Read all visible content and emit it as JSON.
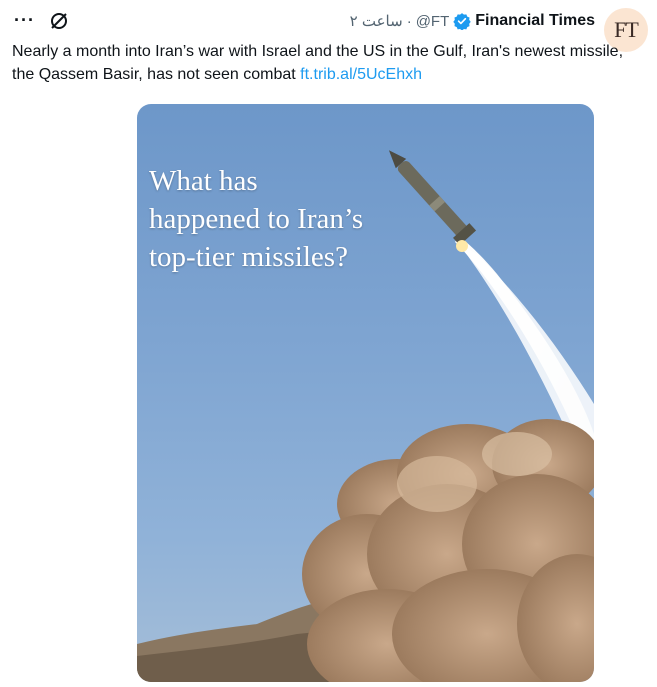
{
  "header": {
    "avatar_text": "FT",
    "name": "Financial Times",
    "handle": "@FT",
    "separator": "·",
    "time": "ساعت ۲"
  },
  "menu": {
    "more": "···"
  },
  "tweet": {
    "text": "Nearly a month into Iran’s war with Israel and the US in the Gulf, Iran's newest missile, the Qassem Basir, has not seen combat ",
    "link": "ft.trib.al/5UcEhxh"
  },
  "media": {
    "headline_lines": [
      "What has",
      "happened to Iran’s",
      "top-tier missiles?"
    ]
  },
  "colors": {
    "verified": "#1d9bf0",
    "link": "#1d9bf0",
    "avatar_bg": "#fbe5d2"
  }
}
